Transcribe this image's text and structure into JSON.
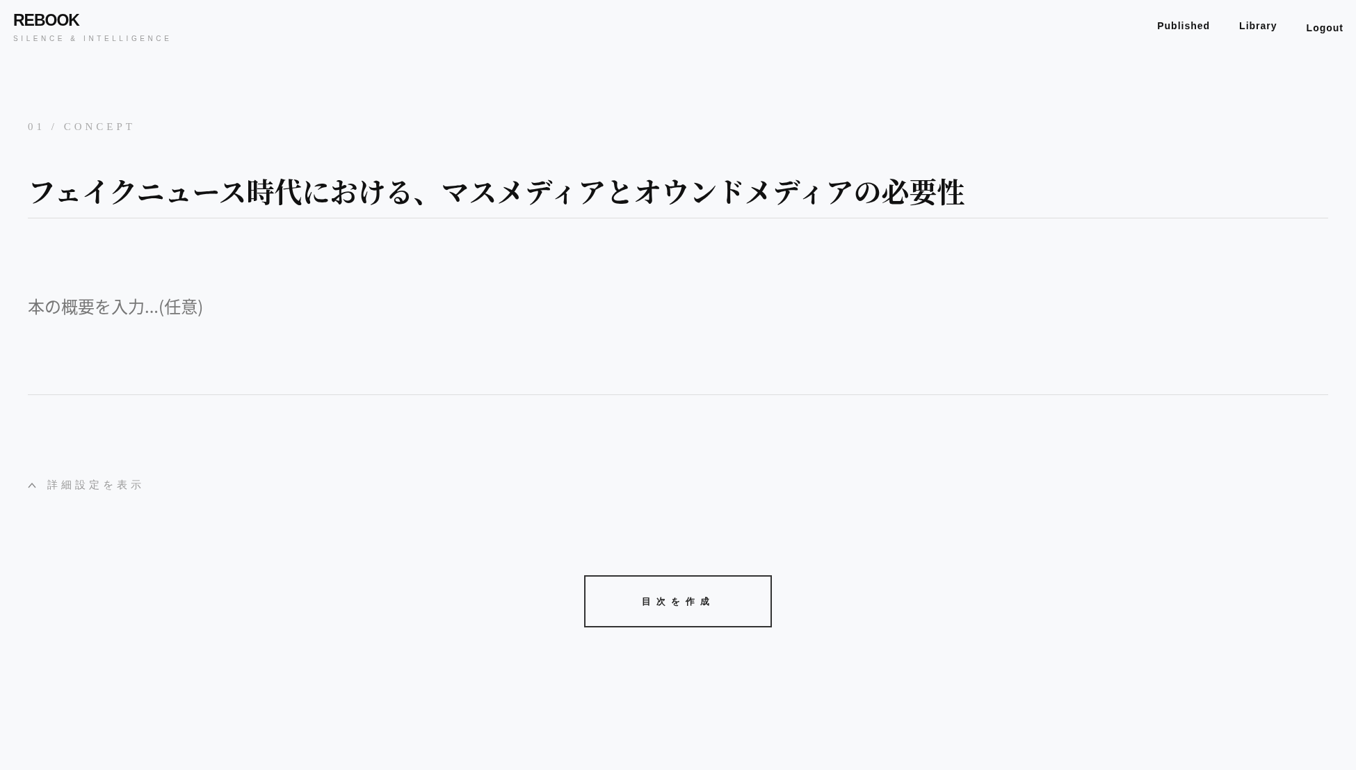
{
  "header": {
    "logo": "REBOOK",
    "tagline": "SILENCE & INTELLIGENCE",
    "nav": [
      "Published",
      "Library",
      "Logout"
    ]
  },
  "section_label": "01 / CONCEPT",
  "title_field": {
    "value": "フェイクニュース時代における、マスメディアとオウンドメディアの必要性"
  },
  "summary_field": {
    "placeholder": "本の概要を入力...(任意)"
  },
  "advanced_toggle": {
    "label": "詳細設定を表示"
  },
  "create_button": {
    "label": "目次を作成"
  }
}
